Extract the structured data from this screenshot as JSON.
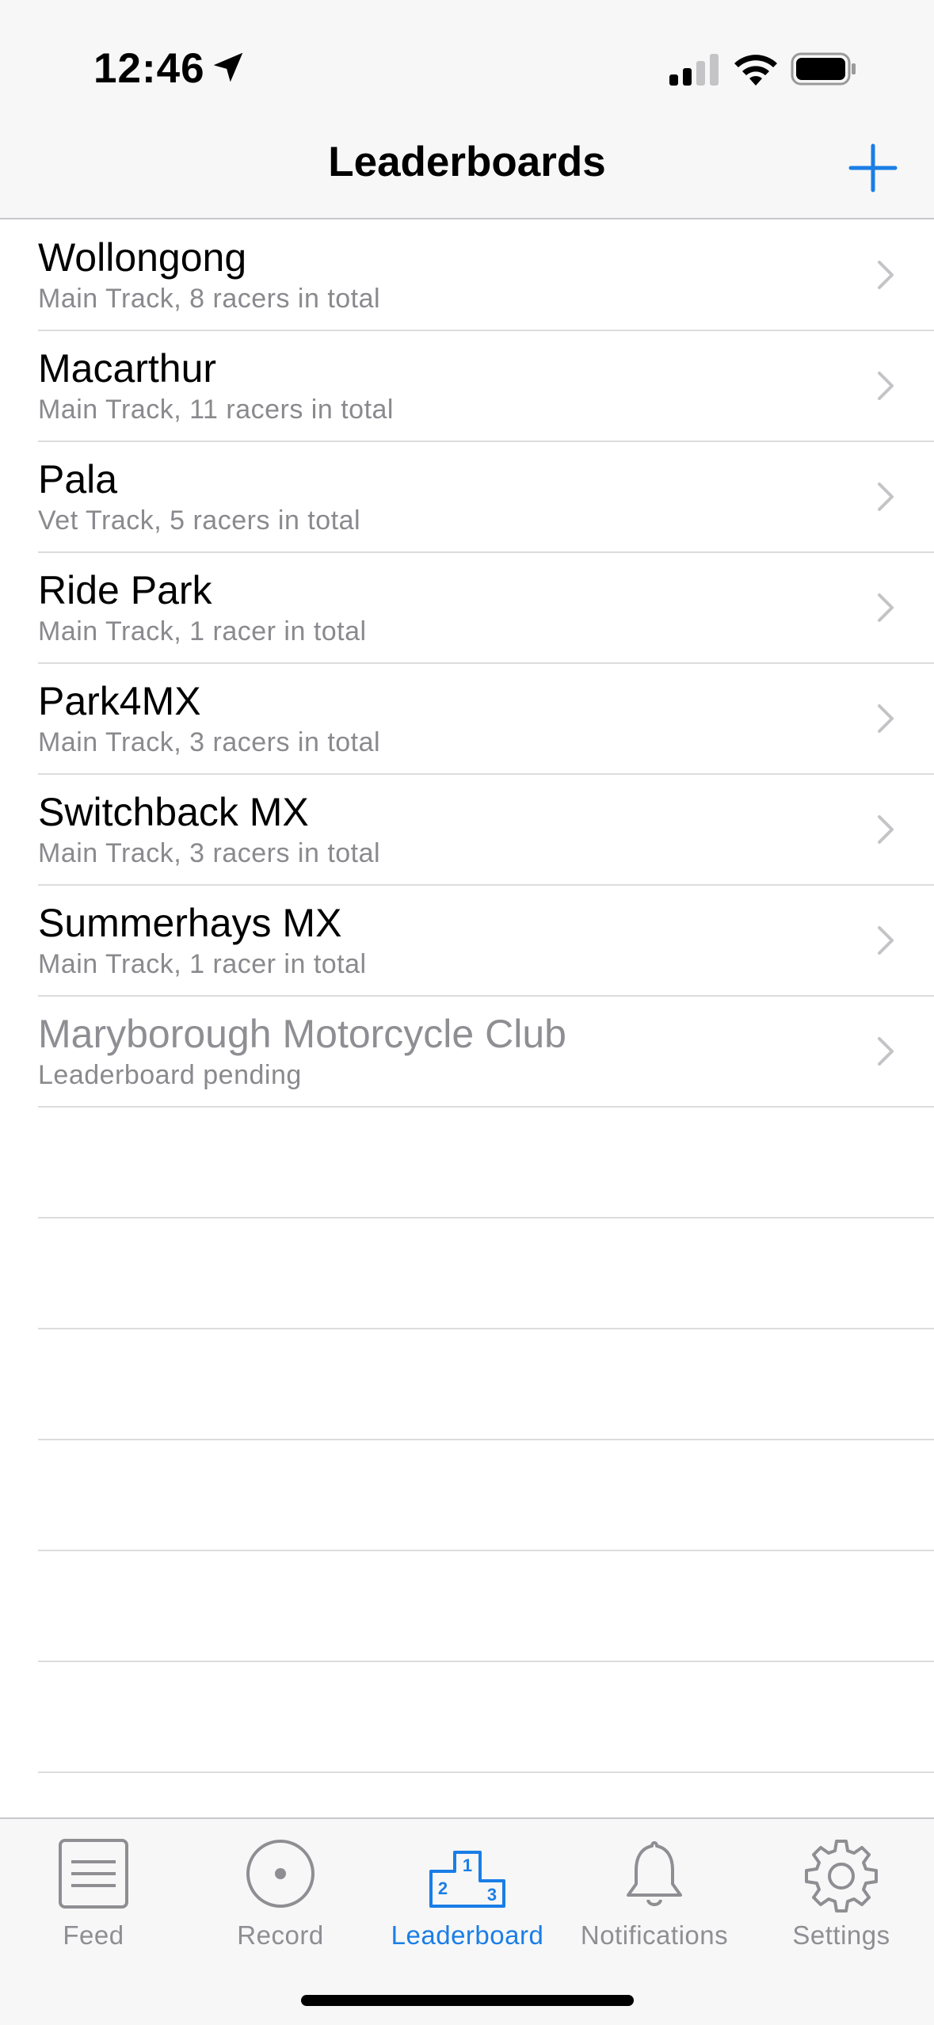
{
  "status_bar": {
    "time": "12:46"
  },
  "nav": {
    "title": "Leaderboards"
  },
  "colors": {
    "accent": "#1a7ee6",
    "secondary_text": "#8a8a8e",
    "pending_text": "#8e8e93"
  },
  "leaderboards": [
    {
      "name": "Wollongong",
      "detail": "Main Track, 8 racers in total"
    },
    {
      "name": "Macarthur",
      "detail": "Main Track, 11 racers in total"
    },
    {
      "name": "Pala",
      "detail": "Vet Track, 5 racers in total"
    },
    {
      "name": "Ride Park",
      "detail": "Main Track, 1 racer in total"
    },
    {
      "name": "Park4MX",
      "detail": "Main Track, 3 racers in total"
    },
    {
      "name": "Switchback MX",
      "detail": "Main Track, 3 racers in total"
    },
    {
      "name": "Summerhays MX",
      "detail": "Main Track, 1 racer in total"
    },
    {
      "name": "Maryborough Motorcycle Club",
      "detail": "Leaderboard pending"
    }
  ],
  "tabs": [
    {
      "label": "Feed",
      "icon": "feed-icon"
    },
    {
      "label": "Record",
      "icon": "record-icon"
    },
    {
      "label": "Leaderboard",
      "icon": "podium-icon",
      "active": true
    },
    {
      "label": "Notifications",
      "icon": "bell-icon"
    },
    {
      "label": "Settings",
      "icon": "gear-icon"
    }
  ]
}
